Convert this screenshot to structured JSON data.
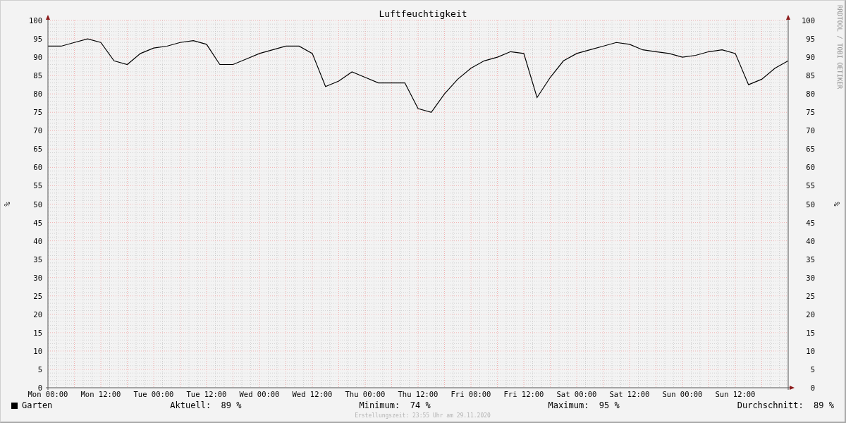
{
  "graph": {
    "signature": "RRDTOOL / TOBI OETIKER",
    "right_axis": {
      "label": "%",
      "ticks": [
        "100",
        "95",
        "90",
        "85",
        "80",
        "75",
        "70",
        "65",
        "60",
        "55",
        "50",
        "45",
        "40",
        "35",
        "30",
        "25",
        "20",
        "15",
        "10",
        "5",
        "0"
      ]
    },
    "chart_data": {
      "type": "line",
      "title": "Luftfeuchtigkeit",
      "ylabel": "%",
      "categories": [
        "Mon 00:00",
        null,
        null,
        null,
        "Mon 12:00",
        null,
        null,
        null,
        "Tue 00:00",
        null,
        null,
        null,
        "Tue 12:00",
        null,
        null,
        null,
        "Wed 00:00",
        null,
        null,
        null,
        "Wed 12:00",
        null,
        null,
        null,
        "Thu 00:00",
        null,
        null,
        null,
        "Thu 12:00",
        null,
        null,
        null,
        "Fri 00:00",
        null,
        null,
        null,
        "Fri 12:00",
        null,
        null,
        null,
        "Sat 00:00",
        null,
        null,
        null,
        "Sat 12:00",
        null,
        null,
        null,
        "Sun 00:00",
        null,
        null,
        null,
        "Sun 12:00",
        null,
        null,
        null,
        null
      ],
      "series": [
        {
          "name": "Garten",
          "color": "#000000",
          "values": [
            93,
            93,
            94,
            95,
            94,
            89,
            88,
            91,
            92.5,
            93,
            94,
            94.5,
            93.5,
            88,
            88,
            89.5,
            91,
            92,
            93,
            93,
            91,
            82,
            83.5,
            86,
            84.5,
            83,
            83,
            83,
            76,
            75,
            80,
            84,
            87,
            89,
            90,
            91.5,
            91,
            79,
            84.5,
            89,
            91,
            92,
            93,
            94,
            93.5,
            92,
            91.5,
            91,
            90,
            90.5,
            91.5,
            92,
            91,
            82.5,
            84,
            87,
            89
          ]
        }
      ],
      "ylim": [
        0,
        100
      ],
      "grid": true,
      "yticks": [
        0,
        5,
        10,
        15,
        20,
        25,
        30,
        35,
        40,
        45,
        50,
        55,
        60,
        65,
        70,
        75,
        80,
        85,
        90,
        95,
        100
      ]
    }
  },
  "legend": {
    "stats": [
      {
        "label": "Aktuell:",
        "value": "89 %"
      },
      {
        "label": "Minimum:",
        "value": "74 %"
      },
      {
        "label": "Maximum:",
        "value": "95 %"
      },
      {
        "label": "Durchschnitt:",
        "value": "89 %"
      }
    ]
  },
  "footer": "Erstellungszeit: 23:55 Uhr am 29.11.2020"
}
